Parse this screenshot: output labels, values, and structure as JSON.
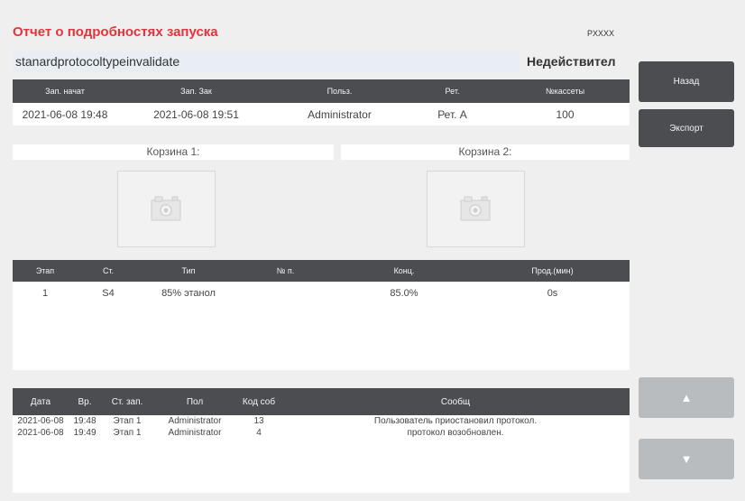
{
  "header": {
    "title": "Отчет о подробностях запуска",
    "instrument": "PXXXX",
    "protocol_name": "stanardprotocoltypeinvalidate",
    "validity": "Недействител"
  },
  "run_table": {
    "columns": [
      "Зап. начат",
      "Зап. Зак",
      "Польз.",
      "Рет.",
      "№кассеты"
    ],
    "rows": [
      [
        "2021-06-08 19:48",
        "2021-06-08 19:51",
        "Administrator",
        "Рет. А",
        "100"
      ]
    ]
  },
  "baskets": {
    "basket1_label": "Корзина 1:",
    "basket2_label": "Корзина 2:"
  },
  "step_table": {
    "columns": [
      "Этап",
      "Ст.",
      "Тип",
      "№ п.",
      "Конц.",
      "Прод.(мин)"
    ],
    "rows": [
      [
        "1",
        "S4",
        "85% этанол",
        "",
        "85.0%",
        "0s"
      ]
    ]
  },
  "event_table": {
    "columns": [
      "Дата",
      "Вр.",
      "Ст. зап.",
      "Пол",
      "Код соб",
      "Сообщ"
    ],
    "rows": [
      [
        "2021-06-08",
        "19:48",
        "Этап 1",
        "Administrator",
        "13",
        "Пользователь приостановил протокол."
      ],
      [
        "2021-06-08",
        "19:49",
        "Этап 1",
        "Administrator",
        "4",
        "протокол возобновлен."
      ]
    ]
  },
  "buttons": {
    "back": "Назад",
    "export": "Экспорт",
    "up_icon": "arrow-up-icon",
    "down_icon": "arrow-down-icon"
  }
}
